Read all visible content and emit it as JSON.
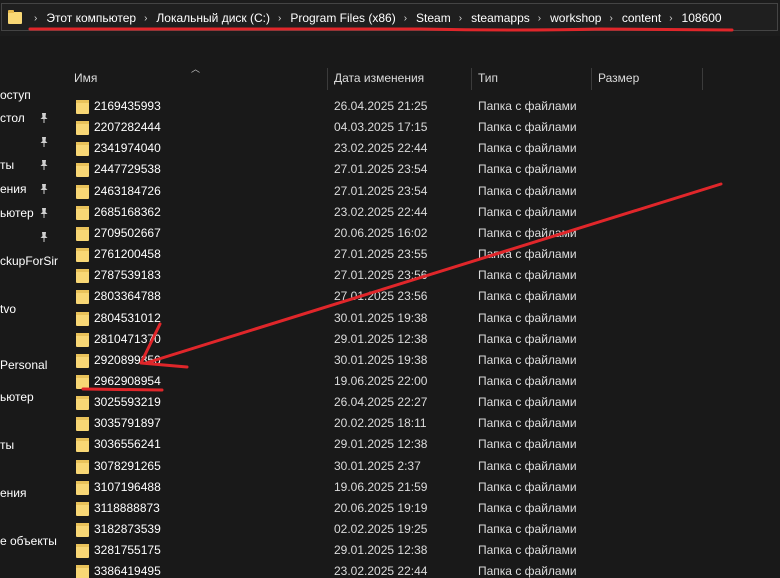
{
  "breadcrumb": [
    "Этот компьютер",
    "Локальный диск (C:)",
    "Program Files (x86)",
    "Steam",
    "steamapps",
    "workshop",
    "content",
    "108600"
  ],
  "nav": {
    "items": [
      {
        "label": "оступ",
        "pinned": false
      },
      {
        "label": "стол",
        "pinned": true
      },
      {
        "label": "",
        "pinned": true
      },
      {
        "label": "ты",
        "pinned": true
      },
      {
        "label": "ения",
        "pinned": true
      },
      {
        "label": "ьютер",
        "pinned": true
      },
      {
        "label": "",
        "pinned": true
      },
      {
        "label": "ckupForSir",
        "pinned": false
      },
      {
        "label": "",
        "pinned": false
      },
      {
        "label": "tvo",
        "pinned": false
      },
      {
        "label": "",
        "pinned": false
      },
      {
        "label": "",
        "pinned": false
      },
      {
        "label": "Personal",
        "pinned": false
      },
      {
        "label": "ьютер",
        "pinned": false
      },
      {
        "label": "",
        "pinned": false
      },
      {
        "label": "ты",
        "pinned": false
      },
      {
        "label": "",
        "pinned": false
      },
      {
        "label": "ения",
        "pinned": false
      },
      {
        "label": "",
        "pinned": false
      },
      {
        "label": "е объекты",
        "pinned": false
      },
      {
        "label": "",
        "pinned": false
      }
    ]
  },
  "columns": {
    "name": "Имя",
    "date": "Дата изменения",
    "type": "Тип",
    "size": "Размер"
  },
  "files": [
    {
      "name": "2169435993",
      "date": "26.04.2025 21:25",
      "type": "Папка с файлами"
    },
    {
      "name": "2207282444",
      "date": "04.03.2025 17:15",
      "type": "Папка с файлами"
    },
    {
      "name": "2341974040",
      "date": "23.02.2025 22:44",
      "type": "Папка с файлами"
    },
    {
      "name": "2447729538",
      "date": "27.01.2025 23:54",
      "type": "Папка с файлами"
    },
    {
      "name": "2463184726",
      "date": "27.01.2025 23:54",
      "type": "Папка с файлами"
    },
    {
      "name": "2685168362",
      "date": "23.02.2025 22:44",
      "type": "Папка с файлами"
    },
    {
      "name": "2709502667",
      "date": "20.06.2025 16:02",
      "type": "Папка с файлами"
    },
    {
      "name": "2761200458",
      "date": "27.01.2025 23:55",
      "type": "Папка с файлами"
    },
    {
      "name": "2787539183",
      "date": "27.01.2025 23:56",
      "type": "Папка с файлами"
    },
    {
      "name": "2803364788",
      "date": "27.01.2025 23:56",
      "type": "Папка с файлами"
    },
    {
      "name": "2804531012",
      "date": "30.01.2025 19:38",
      "type": "Папка с файлами"
    },
    {
      "name": "2810471370",
      "date": "29.01.2025 12:38",
      "type": "Папка с файлами"
    },
    {
      "name": "2920899850",
      "date": "30.01.2025 19:38",
      "type": "Папка с файлами"
    },
    {
      "name": "2962908954",
      "date": "19.06.2025 22:00",
      "type": "Папка с файлами"
    },
    {
      "name": "3025593219",
      "date": "26.04.2025 22:27",
      "type": "Папка с файлами"
    },
    {
      "name": "3035791897",
      "date": "20.02.2025 18:11",
      "type": "Папка с файлами"
    },
    {
      "name": "3036556241",
      "date": "29.01.2025 12:38",
      "type": "Папка с файлами"
    },
    {
      "name": "3078291265",
      "date": "30.01.2025 2:37",
      "type": "Папка с файлами"
    },
    {
      "name": "3107196488",
      "date": "19.06.2025 21:59",
      "type": "Папка с файлами"
    },
    {
      "name": "3118888873",
      "date": "20.06.2025 19:19",
      "type": "Папка с файлами"
    },
    {
      "name": "3182873539",
      "date": "02.02.2025 19:25",
      "type": "Папка с файлами"
    },
    {
      "name": "3281755175",
      "date": "29.01.2025 12:38",
      "type": "Папка с файлами"
    },
    {
      "name": "3386419495",
      "date": "23.02.2025 22:44",
      "type": "Папка с файлами"
    }
  ],
  "icons": {
    "folder": "folder-icon",
    "pin": "pin-icon",
    "separator": "chevron-right-icon",
    "sort": "sort-up-icon"
  },
  "colors": {
    "background": "#191919",
    "folder": "#f8d775",
    "annotation": "#e0262a",
    "text": "#ffffff"
  }
}
